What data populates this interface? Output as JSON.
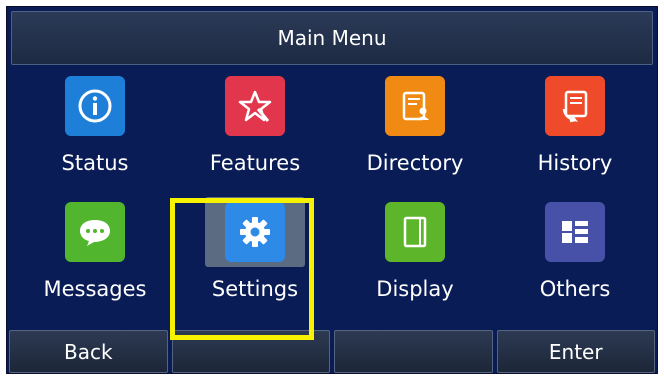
{
  "header": {
    "title": "Main Menu"
  },
  "menu": {
    "items": [
      {
        "label": "Status",
        "icon": "info-icon",
        "color": "#1e7fd8"
      },
      {
        "label": "Features",
        "icon": "star-icon",
        "color": "#e2364c"
      },
      {
        "label": "Directory",
        "icon": "directory-icon",
        "color": "#f08a12"
      },
      {
        "label": "History",
        "icon": "history-icon",
        "color": "#ef4b2a"
      },
      {
        "label": "Messages",
        "icon": "message-icon",
        "color": "#52b52e"
      },
      {
        "label": "Settings",
        "icon": "gear-icon",
        "color": "#2d8ae6",
        "selected": true
      },
      {
        "label": "Display",
        "icon": "display-icon",
        "color": "#5db52a"
      },
      {
        "label": "Others",
        "icon": "grid-icon",
        "color": "#4751a8"
      }
    ]
  },
  "softkeys": {
    "back": "Back",
    "key2": "",
    "key3": "",
    "enter": "Enter"
  },
  "colors": {
    "screen_background": "#0a1c56",
    "highlight_box": "#f7f200",
    "selected_tile": "#5a6b82"
  }
}
